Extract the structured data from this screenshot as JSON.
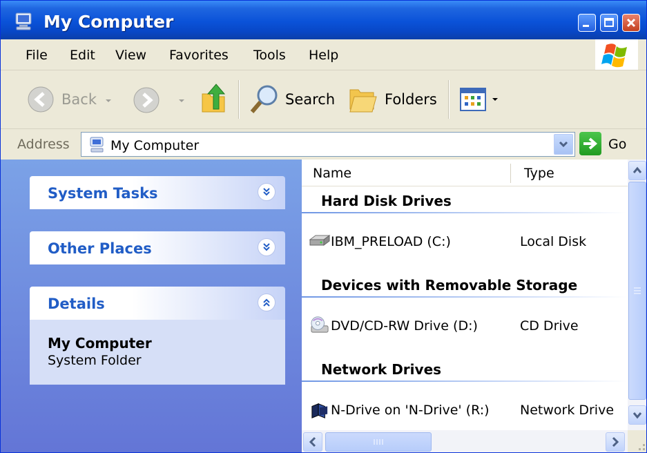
{
  "window": {
    "title": "My Computer",
    "icon": "my-computer-icon"
  },
  "menu": [
    "File",
    "Edit",
    "View",
    "Favorites",
    "Tools",
    "Help"
  ],
  "toolbar": {
    "back": "Back",
    "search": "Search",
    "folders": "Folders"
  },
  "address": {
    "label": "Address",
    "value": "My Computer",
    "go": "Go"
  },
  "left_pane": {
    "system_tasks": "System Tasks",
    "other_places": "Other Places",
    "details": "Details",
    "details_name": "My Computer",
    "details_type": "System Folder"
  },
  "list": {
    "columns": {
      "name": "Name",
      "type": "Type"
    },
    "groups": [
      {
        "title": "Hard Disk Drives",
        "items": [
          {
            "name": "IBM_PRELOAD (C:)",
            "type": "Local Disk",
            "icon": "hard-disk-icon"
          }
        ]
      },
      {
        "title": "Devices with Removable Storage",
        "items": [
          {
            "name": "DVD/CD-RW Drive (D:)",
            "type": "CD Drive",
            "icon": "cd-drive-icon"
          }
        ]
      },
      {
        "title": "Network Drives",
        "items": [
          {
            "name": "N-Drive on 'N-Drive' (R:)",
            "type": "Network Drive",
            "icon": "network-drive-icon"
          }
        ]
      }
    ]
  },
  "colors": {
    "title_bar": "#0a52d8",
    "left_pane": "#6f8fe0",
    "panel_title": "#215dc6",
    "close_button": "#c3401f"
  }
}
